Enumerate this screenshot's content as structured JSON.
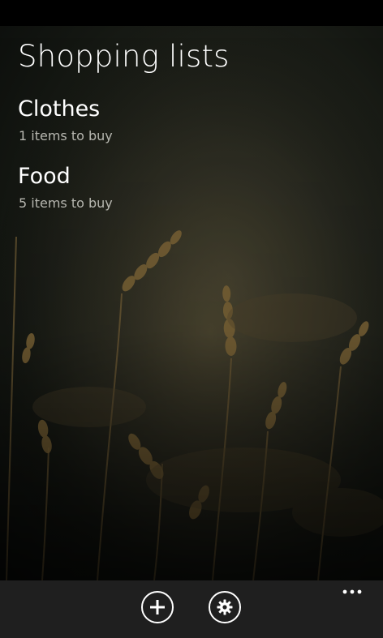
{
  "page": {
    "title": "Shopping lists"
  },
  "lists": [
    {
      "name": "Clothes",
      "subtitle": "1 items to buy"
    },
    {
      "name": "Food",
      "subtitle": "5 items to buy"
    }
  ],
  "app_bar": {
    "buttons": [
      {
        "icon": "add-icon"
      },
      {
        "icon": "gear-icon"
      }
    ],
    "more_icon": "more-dots-icon",
    "background": "#1f1f1f"
  },
  "background": {
    "image": "wheat-field-photo"
  }
}
